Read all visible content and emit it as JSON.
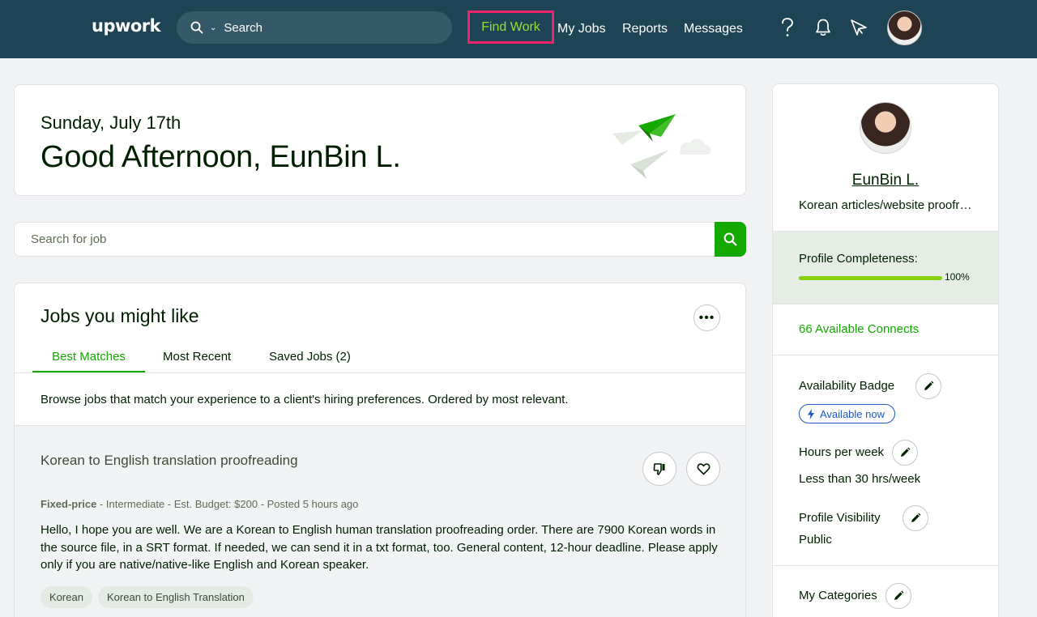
{
  "header": {
    "logo": "upwork",
    "search_placeholder": "Search",
    "nav": {
      "find_work": "Find Work",
      "my_jobs": "My Jobs",
      "reports": "Reports",
      "messages": "Messages"
    },
    "icons": [
      "search-icon",
      "chevron-down-icon",
      "help-icon",
      "bell-icon",
      "send-icon"
    ]
  },
  "greeting": {
    "date": "Sunday, July 17th",
    "message": "Good Afternoon, EunBin L."
  },
  "job_search": {
    "placeholder": "Search for job"
  },
  "jobs_section": {
    "title": "Jobs you might like",
    "more_label": "•••",
    "tabs": [
      "Best Matches",
      "Most Recent",
      "Saved Jobs (2)"
    ],
    "active_tab": "Best Matches",
    "browse_text": "Browse jobs that match your experience to a client's hiring preferences. Ordered by most relevant.",
    "job": {
      "title": "Korean to English translation proofreading",
      "type": "Fixed-price",
      "meta_rest": " - Intermediate - Est. Budget: $200 - Posted 5 hours ago",
      "description": "Hello, I hope you are well. We are a Korean to English human translation proofreading order. There are 7900 Korean words in the source file, in a SRT format. If needed, we can send it in a txt format, too. General content, 12-hour deadline. Please apply only if you are native/native-like English and Korean speaker.",
      "skills": [
        "Korean",
        "Korean to English Translation"
      ]
    }
  },
  "sidebar": {
    "name": "EunBin L.",
    "tagline": "Korean articles/website proofreading",
    "profile_completeness_label": "Profile Completeness:",
    "profile_completeness_value": 1.0,
    "profile_completeness_text": "100%",
    "connects": "66 Available Connects",
    "availability_badge_label": "Availability Badge",
    "availability_status": "Available now",
    "hours_label": "Hours per week",
    "hours_value": "Less than 30 hrs/week",
    "visibility_label": "Profile Visibility",
    "visibility_value": "Public",
    "categories_label": "My Categories"
  },
  "colors": {
    "header_bg": "#1d4354",
    "accent_green": "#14a800",
    "nav_active": "#9ade36",
    "highlight_box": "#f0226b",
    "badge_blue": "#1f57c3"
  }
}
